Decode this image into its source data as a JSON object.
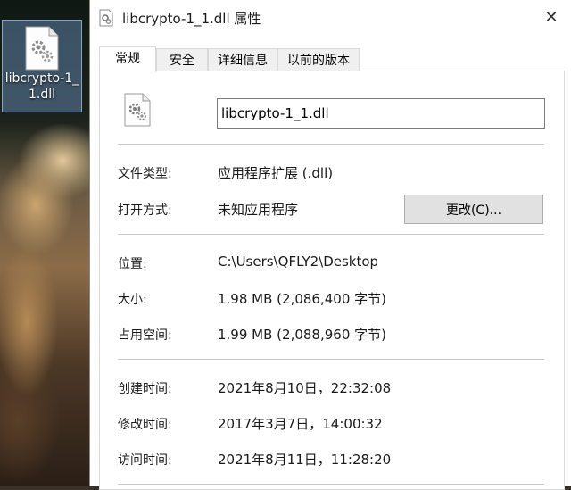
{
  "desktop": {
    "icon_label": "libcrypto-1_1.dll"
  },
  "dialog": {
    "title": "libcrypto-1_1.dll 属性",
    "close_glyph": "✕",
    "tabs": [
      {
        "label": "常规",
        "active": true
      },
      {
        "label": "安全",
        "active": false
      },
      {
        "label": "详细信息",
        "active": false
      },
      {
        "label": "以前的版本",
        "active": false
      }
    ],
    "filename": "libcrypto-1_1.dll",
    "file_type_label": "文件类型:",
    "file_type_value": "应用程序扩展 (.dll)",
    "open_with_label": "打开方式:",
    "open_with_value": "未知应用程序",
    "change_button": "更改(C)...",
    "location_label": "位置:",
    "location_value": "C:\\Users\\QFLY2\\Desktop",
    "size_label": "大小:",
    "size_value": "1.98 MB (2,086,400 字节)",
    "size_on_disk_label": "占用空间:",
    "size_on_disk_value": "1.99 MB (2,088,960 字节)",
    "created_label": "创建时间:",
    "created_value": "2021年8月10日，22:32:08",
    "modified_label": "修改时间:",
    "modified_value": "2017年3月7日，14:00:32",
    "accessed_label": "访问时间:",
    "accessed_value": "2021年8月11日，11:28:20"
  },
  "icons": {
    "file_icon": "dll-gear-file-icon",
    "close_icon": "close-icon"
  }
}
